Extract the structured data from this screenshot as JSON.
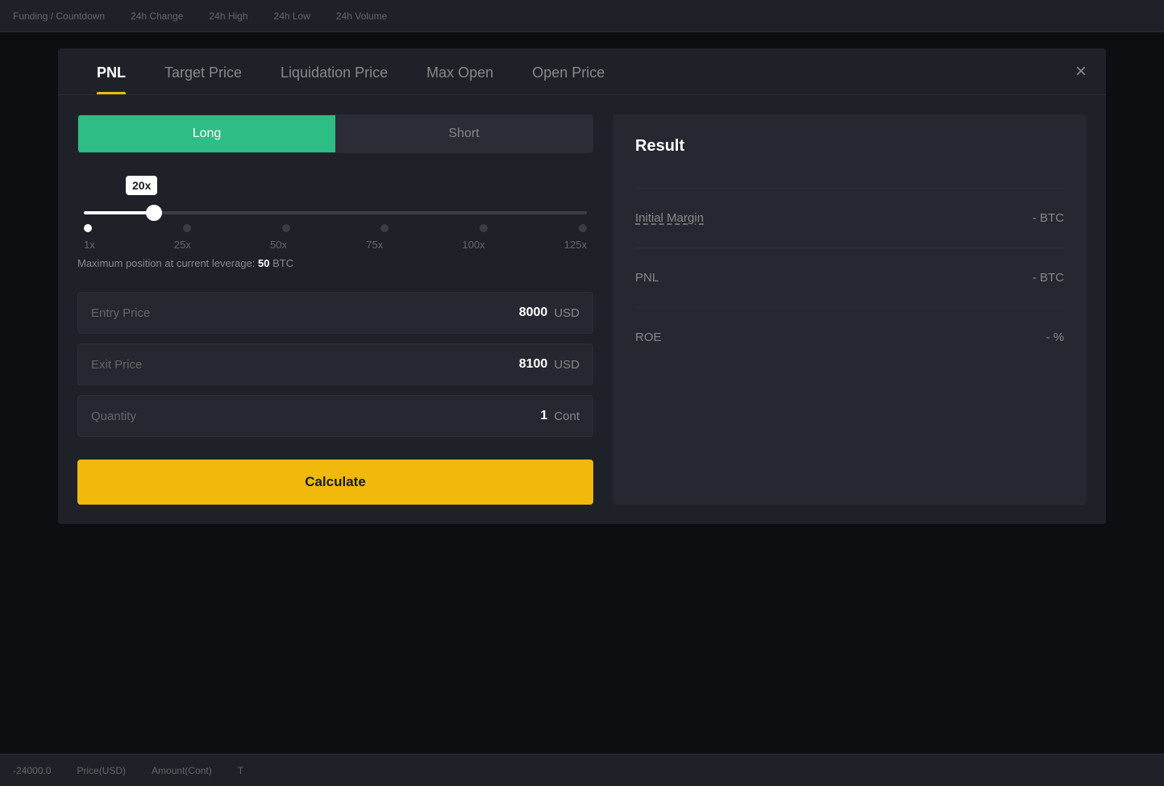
{
  "topBar": {
    "items": [
      "Funding / Countdown",
      "24h Change",
      "24h High",
      "24h Low",
      "24h Volume"
    ]
  },
  "bottomBar": {
    "items": [
      "-24000.0",
      "Price(USD)",
      "Amount(Cont)",
      "T"
    ]
  },
  "modal": {
    "tabs": [
      {
        "id": "pnl",
        "label": "PNL",
        "active": true
      },
      {
        "id": "target-price",
        "label": "Target Price",
        "active": false
      },
      {
        "id": "liquidation-price",
        "label": "Liquidation Price",
        "active": false
      },
      {
        "id": "max-open",
        "label": "Max Open",
        "active": false
      },
      {
        "id": "open-price",
        "label": "Open Price",
        "active": false
      }
    ],
    "closeLabel": "×",
    "toggle": {
      "long": "Long",
      "short": "Short",
      "activeTab": "long"
    },
    "leverage": {
      "badge": "20x",
      "marks": [
        "1x",
        "25x",
        "50x",
        "75x",
        "100x",
        "125x"
      ],
      "currentValue": 20,
      "sliderPercent": 15
    },
    "maxPosition": {
      "text": "Maximum position at current leverage:",
      "value": "50",
      "unit": "BTC"
    },
    "fields": [
      {
        "id": "entry-price",
        "label": "Entry Price",
        "value": "8000",
        "unit": "USD"
      },
      {
        "id": "exit-price",
        "label": "Exit Price",
        "value": "8100",
        "unit": "USD"
      },
      {
        "id": "quantity",
        "label": "Quantity",
        "value": "1",
        "unit": "Cont"
      }
    ],
    "calculateButton": "Calculate",
    "result": {
      "title": "Result",
      "rows": [
        {
          "id": "initial-margin",
          "label": "Initial Margin",
          "value": "- BTC",
          "underline": true
        },
        {
          "id": "pnl",
          "label": "PNL",
          "value": "- BTC",
          "underline": false
        },
        {
          "id": "roe",
          "label": "ROE",
          "value": "- %",
          "underline": false
        }
      ]
    }
  },
  "colors": {
    "accent": "#f0b90b",
    "long": "#2ebd85",
    "short": "#ff5757",
    "bg": "#1a1d22",
    "panel": "#1e2128",
    "input": "#252830"
  }
}
